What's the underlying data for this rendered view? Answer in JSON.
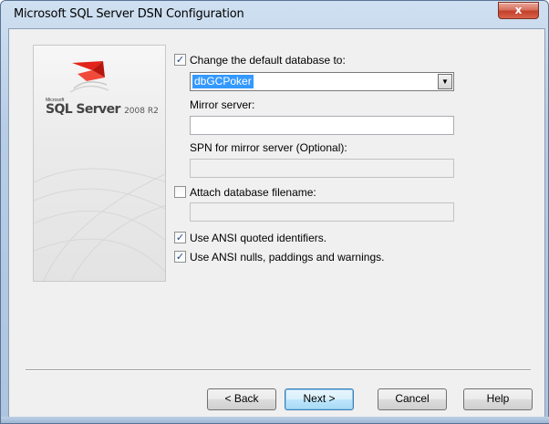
{
  "window": {
    "title": "Microsoft SQL Server DSN Configuration",
    "close_glyph": "x"
  },
  "brand": {
    "microsoft": "Microsoft",
    "product": "SQL Server",
    "version": "2008 R2",
    "logo_icon": "sql-server-logo-icon"
  },
  "options": {
    "change_default_db": {
      "label": "Change the default database to:",
      "checked": true
    },
    "database_value": "dbGCPoker",
    "mirror_server_label": "Mirror server:",
    "mirror_server_value": "",
    "spn_label": "SPN for mirror server (Optional):",
    "spn_value": "",
    "attach_db": {
      "label": "Attach database filename:",
      "checked": false
    },
    "attach_db_value": "",
    "ansi_quoted": {
      "label": "Use ANSI quoted identifiers.",
      "checked": true
    },
    "ansi_nulls": {
      "label": "Use ANSI nulls, paddings and warnings.",
      "checked": true
    },
    "check_glyph": "✓"
  },
  "buttons": {
    "back": "< Back",
    "next": "Next >",
    "cancel": "Cancel",
    "help": "Help"
  },
  "colors": {
    "selection": "#3399ff",
    "dialog_bg": "#f0f0f0",
    "close_red": "#c3402a"
  }
}
